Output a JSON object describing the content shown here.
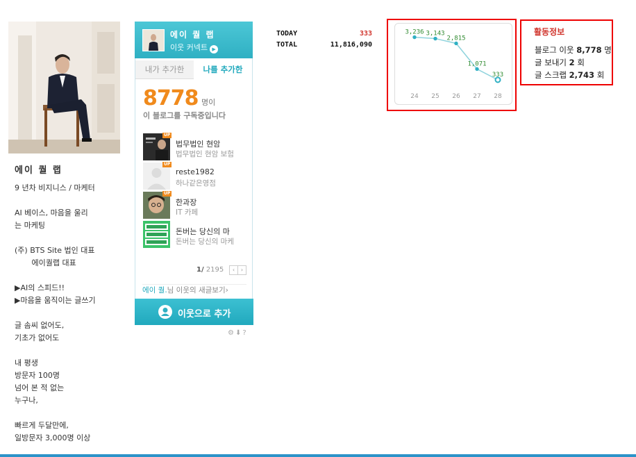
{
  "profile": {
    "name": "에이 퀄 랩",
    "bio": [
      "9 년차 비지니스 / 마케터",
      "AI 베이스, 마음을 울리\n는 마케팅",
      "(주) BTS Site 법인 대표\n       에이퀄랩 대표",
      "▶AI의 스피드!!\n▶마음을 움직이는 글쓰기",
      "글 솜씨 없어도,\n기초가 없어도",
      "내 평생\n방문자 100명\n넘어 본 적 없는\n누구나,",
      "빠르게 두달만에,\n일방문자 3,000명 이상"
    ]
  },
  "neighbor_widget": {
    "title": "에이 퀄 랩",
    "subtitle": "이웃 커넥트",
    "subtitle_arrow": "▶",
    "tabs": [
      "내가 추가한",
      "나를 추가한"
    ],
    "count": "8778",
    "count_unit": "명이",
    "count_desc": "이 블로그를 구독중입니다",
    "items": [
      {
        "name": "법무법인 현암",
        "desc": "법무법인 현암 보험",
        "up": "UP"
      },
      {
        "name": "reste1982",
        "desc": "하나같은영점",
        "up": "UP"
      },
      {
        "name": "한과장",
        "desc": "IT 카페",
        "up": "UP"
      },
      {
        "name": "돈버는 당신의 마",
        "desc": "돈버는 당신의 마케",
        "up": ""
      }
    ],
    "page_current": "1/",
    "page_total": "2195",
    "prev": "‹",
    "next": "›",
    "feed_user": "에이 퀄.",
    "feed_text": "님 이웃의 새글보기",
    "feed_arrow": "›",
    "add_button": "이웃으로 추가",
    "tools": "⚙⬇?"
  },
  "stats": {
    "today_label": "TODAY",
    "today_value": "333",
    "total_label": "TOTAL",
    "total_value": "11,816,090"
  },
  "chart_data": {
    "type": "line",
    "x": [
      "24",
      "25",
      "26",
      "27",
      "28"
    ],
    "values": [
      3236,
      3143,
      2815,
      1071,
      333
    ],
    "value_labels": [
      "3,236",
      "3,143",
      "2,815",
      "1,071",
      "333"
    ],
    "ylim": [
      0,
      3500
    ],
    "grid": false,
    "colors": {
      "line": "#8fd3dd",
      "point": "#2fb0c3",
      "label": "#2f8a2f"
    }
  },
  "activity": {
    "title": "활동정보",
    "rows": [
      {
        "label": "블로그 이웃",
        "value": "8,778",
        "unit": "명"
      },
      {
        "label": "글 보내기",
        "value": "2",
        "unit": "회"
      },
      {
        "label": "글 스크랩",
        "value": "2,743",
        "unit": "회"
      }
    ]
  }
}
